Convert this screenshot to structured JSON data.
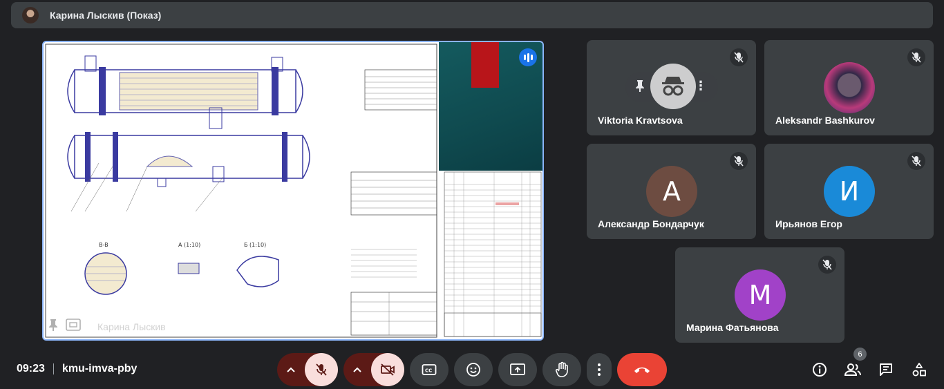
{
  "header": {
    "presenter_title": "Карина Лыскив (Показ)"
  },
  "presentation": {
    "presenter_name": "Карина Лыскив"
  },
  "participants": [
    {
      "name": "Viktoria Kravtsova",
      "initial": "",
      "color": "#3c4043"
    },
    {
      "name": "Aleksandr Bashkurov",
      "initial": "",
      "color": "#3c4043"
    },
    {
      "name": "Александр Бондарчук",
      "initial": "A",
      "color": "#6d4c41"
    },
    {
      "name": "Ирьянов Егор",
      "initial": "И",
      "color": "#1a8ad8"
    },
    {
      "name": "Марина Фатьянова",
      "initial": "M",
      "color": "#a142c8"
    }
  ],
  "footer": {
    "time": "09:23",
    "meeting_code": "kmu-imva-pby",
    "participants_count": "6"
  },
  "controls": {
    "mic": "mic-off-icon",
    "camera": "camera-off-icon",
    "captions": "captions-icon",
    "emoji": "emoji-icon",
    "present": "present-icon",
    "hand": "raise-hand-icon",
    "more": "more-icon",
    "leave": "leave-call-icon"
  },
  "colors": {
    "background": "#202124",
    "tile": "#3c4043",
    "accent": "#8ab4f8",
    "danger": "#ea4335",
    "muted_control": "#f9dedc"
  }
}
